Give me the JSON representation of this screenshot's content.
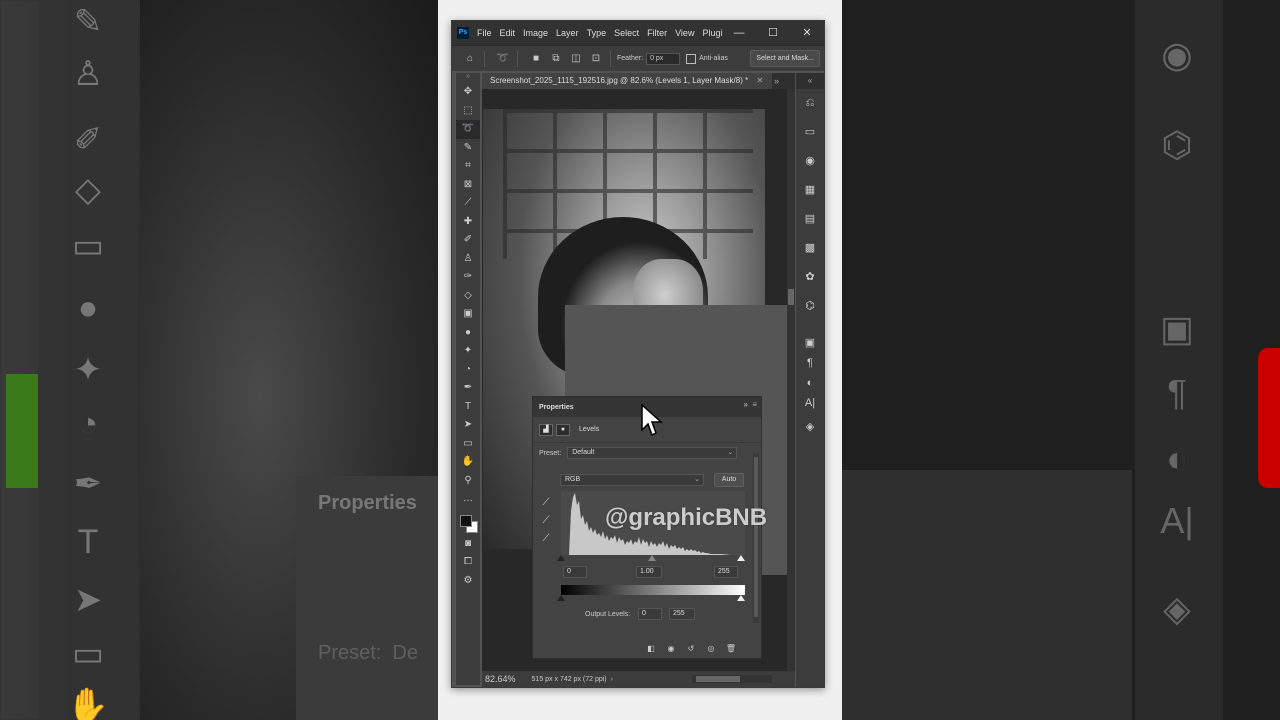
{
  "app": {
    "logo_text": "Ps",
    "menus": [
      "File",
      "Edit",
      "Image",
      "Layer",
      "Type",
      "Select",
      "Filter",
      "View",
      "Plugi"
    ],
    "window_controls": {
      "minimize": "—",
      "maximize": "☐",
      "close": "✕"
    }
  },
  "options_bar": {
    "feather_label": "Feather:",
    "feather_value": "0 px",
    "anti_alias_label": "Anti-alias",
    "select_mask_label": "Select and Mask..."
  },
  "document": {
    "tab_title": "Screenshot_2025_1115_192516.jpg @ 82.6% (Levels 1, Layer Mask/8) *",
    "collapse_label": "»",
    "zoom": "82.64%",
    "doc_info": "515 px x 742 px (72 ppi)"
  },
  "properties": {
    "title": "Properties",
    "adjustment_name": "Levels",
    "preset_label": "Preset:",
    "preset_value": "Default",
    "channel_value": "RGB",
    "auto_label": "Auto",
    "input_black": "0",
    "input_gamma": "1.00",
    "input_white": "255",
    "output_label": "Output Levels:",
    "output_black": "0",
    "output_white": "255"
  },
  "watermark": "@graphicBNB",
  "background_mirror": {
    "properties_title": "Properties",
    "preset_label": "Preset:",
    "preset_value": "De"
  },
  "icons": {
    "tools": [
      "move-icon",
      "marquee-icon",
      "lasso-icon",
      "quick-select-icon",
      "crop-icon",
      "frame-icon",
      "eyedropper-icon",
      "healing-icon",
      "brush-icon",
      "stamp-icon",
      "history-brush-icon",
      "eraser-icon",
      "gradient-icon",
      "blur-icon",
      "dodge-icon",
      "burn-icon",
      "pen-icon",
      "type-icon",
      "path-select-icon",
      "rectangle-icon",
      "hand-icon",
      "zoom-icon",
      "more-icon"
    ]
  }
}
